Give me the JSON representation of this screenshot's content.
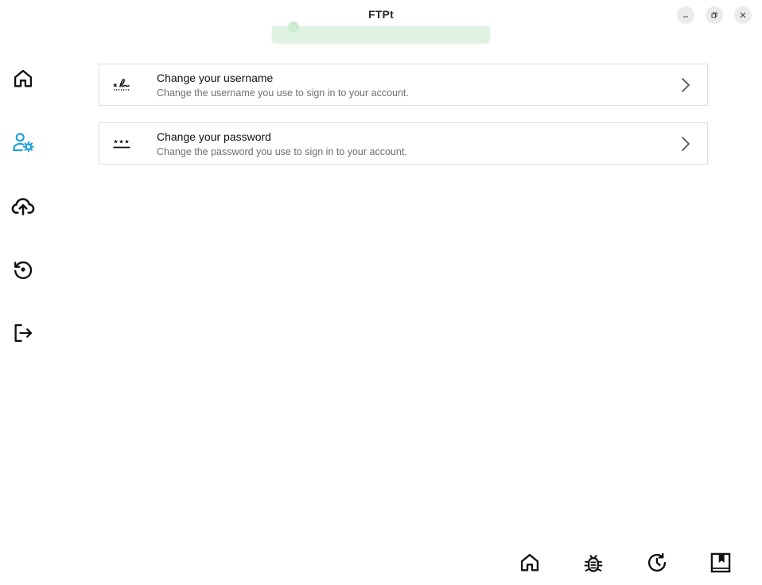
{
  "app": {
    "title": "FTPt"
  },
  "window_controls": {
    "minimize_icon": "minimize-icon",
    "maximize_icon": "restore-icon",
    "close_icon": "close-icon"
  },
  "nav": {
    "items": [
      {
        "id": "home",
        "icon": "home-icon",
        "active": false
      },
      {
        "id": "account-settings",
        "icon": "user-gear-icon",
        "active": true
      },
      {
        "id": "upload",
        "icon": "cloud-upload-icon",
        "active": false
      },
      {
        "id": "history",
        "icon": "history-icon",
        "active": false
      },
      {
        "id": "logout",
        "icon": "logout-icon",
        "active": false
      }
    ],
    "active_color": "#1a9fe0",
    "icon_color": "#111111"
  },
  "settings": {
    "items": [
      {
        "icon": "signature-icon",
        "title": "Change your username",
        "description": "Change the username you use to sign in to your account."
      },
      {
        "icon": "password-icon",
        "title": "Change your password",
        "description": "Change the password you use to sign in to your account."
      }
    ]
  },
  "toast": {
    "color": "#dff3e2"
  },
  "bottom_bar": {
    "items": [
      {
        "id": "home",
        "icon": "home-icon"
      },
      {
        "id": "bug",
        "icon": "bug-icon"
      },
      {
        "id": "history",
        "icon": "clock-refresh-icon"
      },
      {
        "id": "book",
        "icon": "book-icon"
      }
    ]
  }
}
